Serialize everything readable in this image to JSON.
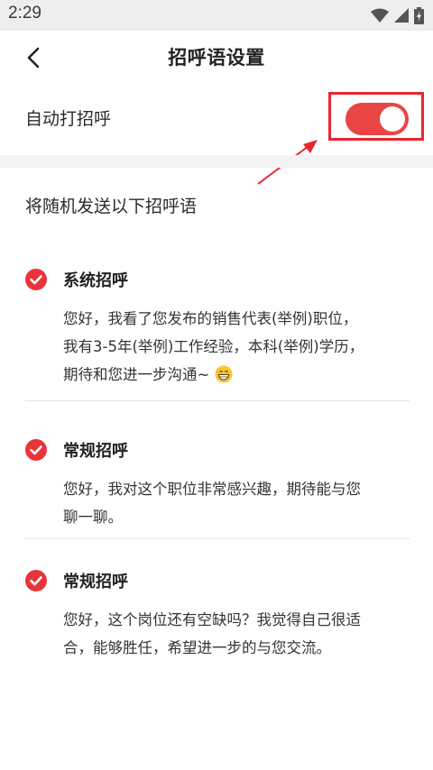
{
  "status_bar": {
    "time": "2:29",
    "icons": [
      "wifi-icon",
      "signal-icon",
      "battery-charging-icon"
    ]
  },
  "header": {
    "back_icon": "chevron-left-icon",
    "title": "招呼语设置"
  },
  "auto_greet": {
    "label": "自动打招呼",
    "enabled": true,
    "toggle_color": "#e94545"
  },
  "section": {
    "title": "将随机发送以下招呼语"
  },
  "greetings": [
    {
      "title": "系统招呼",
      "lines": [
        "您好，我看了您发布的销售代表(举例)职位，",
        "我有3-5年(举例)工作经验，本科(举例)学历，",
        "期待和您进一步沟通~"
      ],
      "emoji": "grinning-face-emoji",
      "checked": true
    },
    {
      "title": "常规招呼",
      "lines": [
        "您好，我对这个职位非常感兴趣，期待能与您",
        "聊一聊。"
      ],
      "checked": true
    },
    {
      "title": "常规招呼",
      "lines": [
        "您好，这个岗位还有空缺吗？我觉得自己很适",
        "合，能够胜任，希望进一步的与您交流。"
      ],
      "checked": true
    }
  ],
  "annotation_color": "#e8262f"
}
